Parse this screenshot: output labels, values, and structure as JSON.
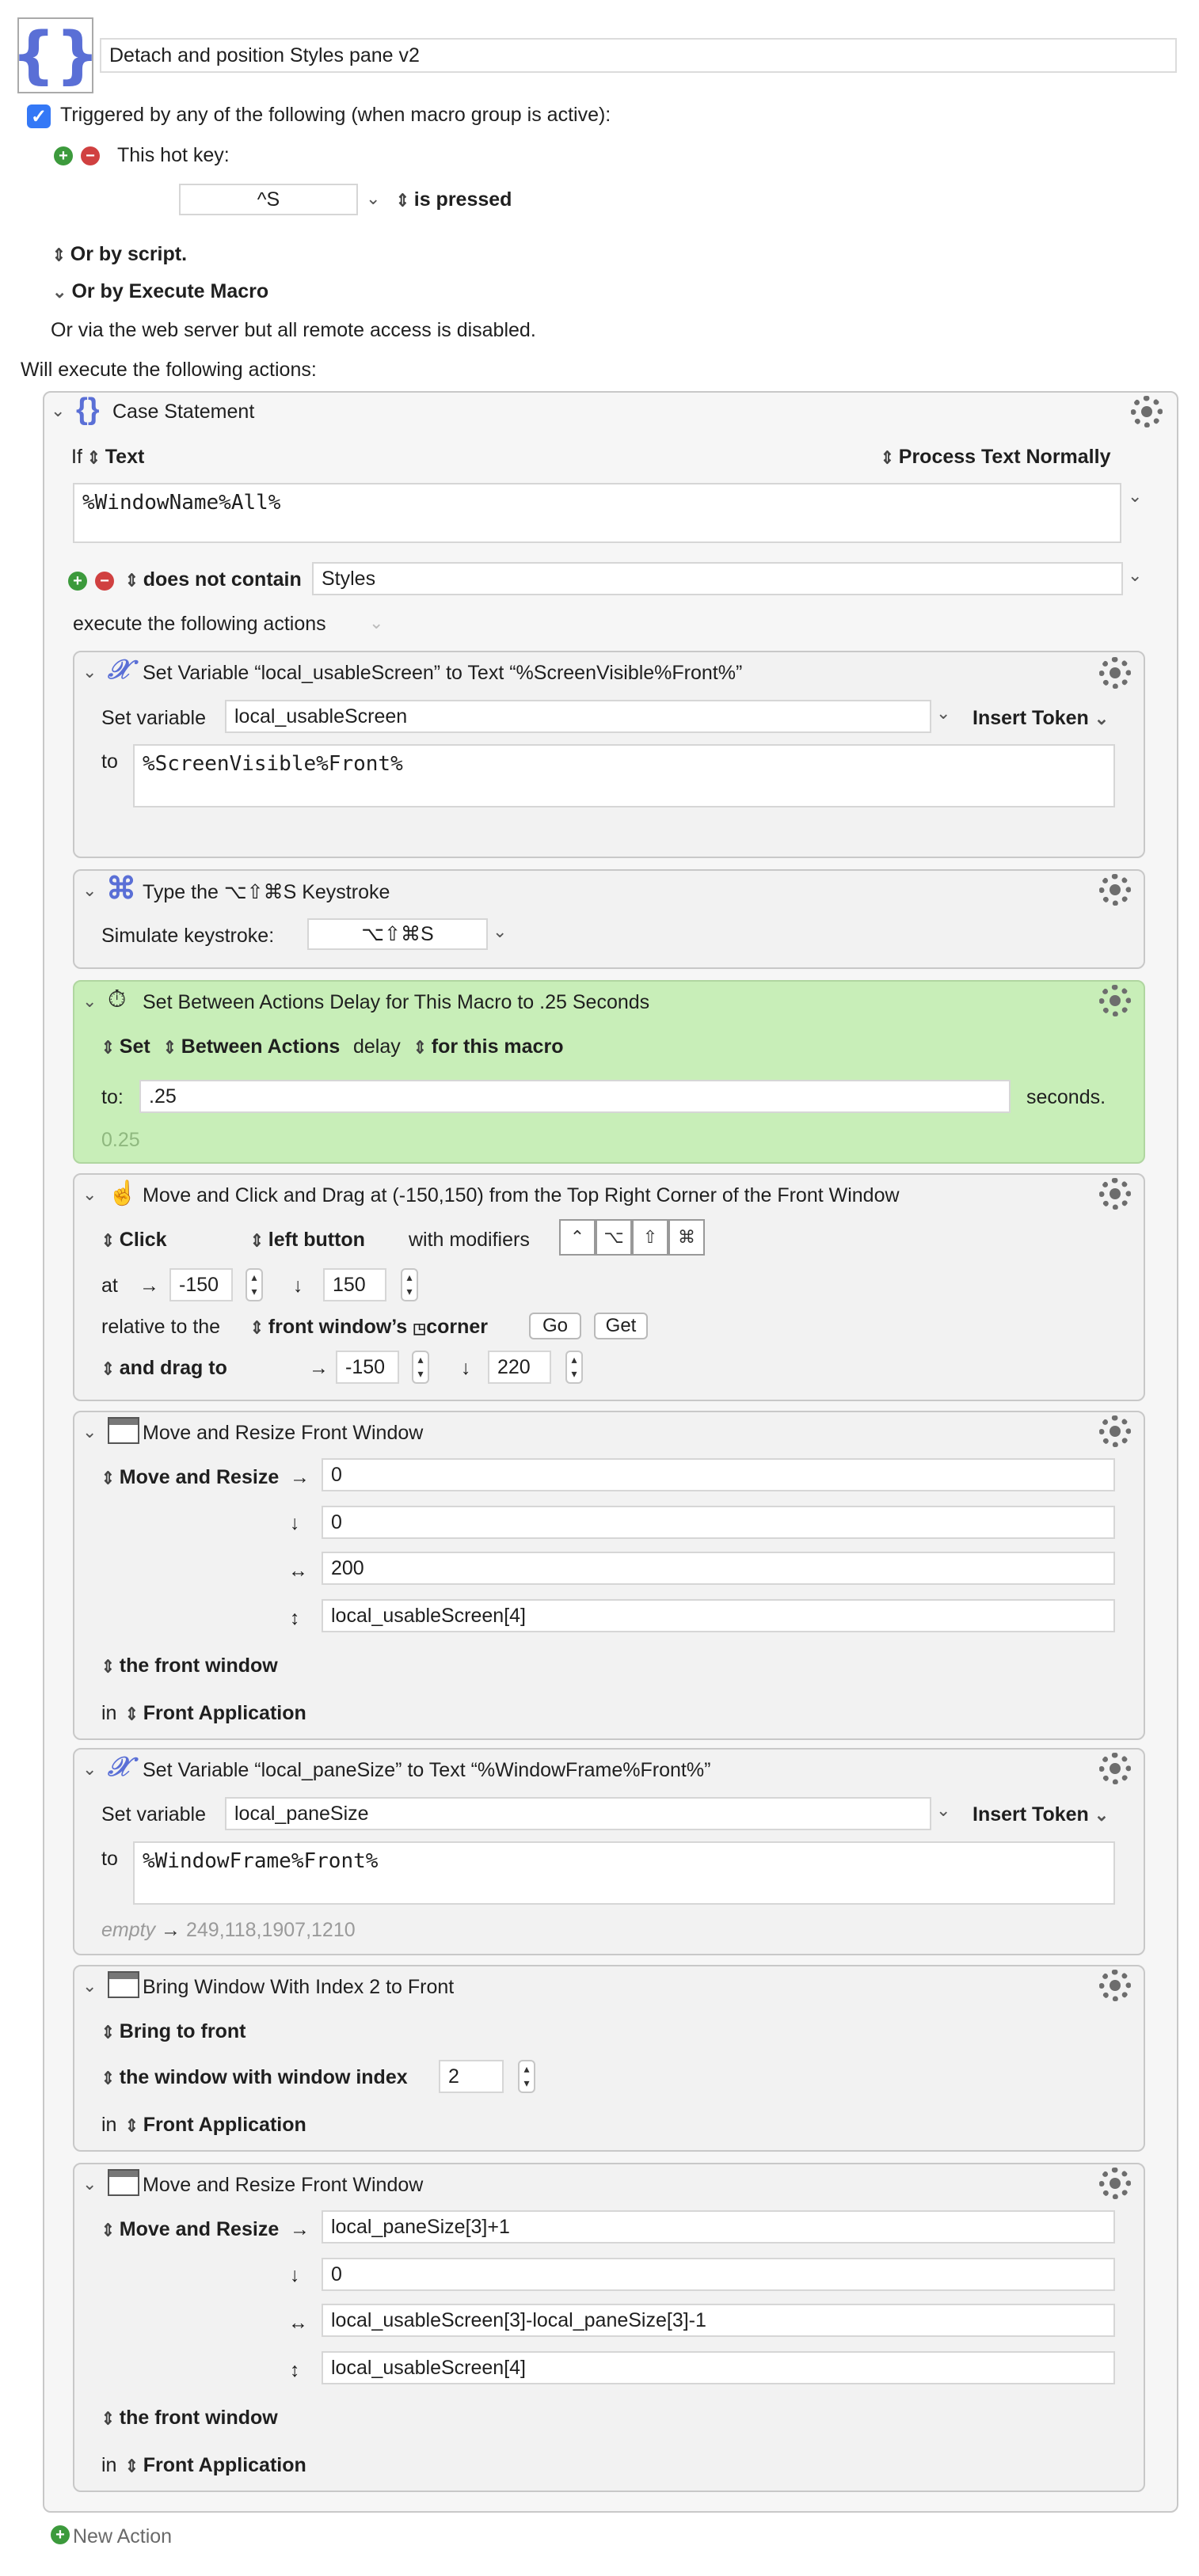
{
  "macro": {
    "name": "Detach and position Styles pane v2",
    "trigger_text": "Triggered by any of the following (when macro group is active):",
    "hotkey_label": "This hot key:",
    "hotkey": "^S",
    "is_pressed": "is pressed",
    "or_by_script": "Or by script.",
    "or_by_execute": "Or by Execute Macro",
    "web_server": "Or via the web server but all remote access is disabled.",
    "will_execute": "Will execute the following actions:"
  },
  "case": {
    "title": "Case Statement",
    "if_label": "If",
    "type": "Text",
    "process": "Process Text Normally",
    "text": "%WindowName%All%",
    "condition": "does not contain",
    "condition_value": "Styles",
    "execute_label": "execute the following actions"
  },
  "a1": {
    "title": "Set Variable “local_usableScreen” to Text “%ScreenVisible%Front%”",
    "set_label": "Set variable",
    "variable": "local_usableScreen",
    "insert_token": "Insert Token",
    "to_label": "to",
    "value": "%ScreenVisible%Front%"
  },
  "a2": {
    "title": "Type the ⌥⇧⌘S Keystroke",
    "label": "Simulate keystroke:",
    "keystroke": "⌥⇧⌘S"
  },
  "a3": {
    "title": "Set Between Actions Delay for This Macro to .25 Seconds",
    "set": "Set",
    "between": "Between Actions",
    "delay": "delay",
    "for_macro": "for this macro",
    "to_label": "to:",
    "value": ".25",
    "seconds": "seconds.",
    "preview": "0.25"
  },
  "a4": {
    "title": "Move and Click and Drag at (-150,150) from the Top Right Corner of the Front Window",
    "click": "Click",
    "button": "left button",
    "with_modifiers": "with modifiers",
    "at_label": "at",
    "x": "-150",
    "y": "150",
    "relative": "relative to the",
    "front_window": "front window’s",
    "corner": "corner",
    "go": "Go",
    "get": "Get",
    "drag_to": "and drag to",
    "drag_x": "-150",
    "drag_y": "220"
  },
  "a5": {
    "title": "Move and Resize Front Window",
    "mode": "Move and Resize",
    "x": "0",
    "y": "0",
    "w": "200",
    "h": "local_usableScreen[4]",
    "target": "the front window",
    "in_label": "in",
    "app": "Front Application"
  },
  "a6": {
    "title": "Set Variable “local_paneSize” to Text “%WindowFrame%Front%”",
    "set_label": "Set variable",
    "variable": "local_paneSize",
    "insert_token": "Insert Token",
    "to_label": "to",
    "value": "%WindowFrame%Front%",
    "preview_empty": "empty",
    "preview_value": "249,118,1907,1210"
  },
  "a7": {
    "title": "Bring Window With Index 2 to Front",
    "mode": "Bring to front",
    "target": "the window with window index",
    "index": "2",
    "in_label": "in",
    "app": "Front Application"
  },
  "a8": {
    "title": "Move and Resize Front Window",
    "mode": "Move and Resize",
    "x": "local_paneSize[3]+1",
    "y": "0",
    "w": "local_usableScreen[3]-local_paneSize[3]-1",
    "h": "local_usableScreen[4]",
    "target": "the front window",
    "in_label": "in",
    "app": "Front Application"
  },
  "new_action": "New Action",
  "colors": {
    "accent": "#5a6fd6",
    "green_action": "#c8eeb8",
    "checkbox": "#3478f6"
  }
}
